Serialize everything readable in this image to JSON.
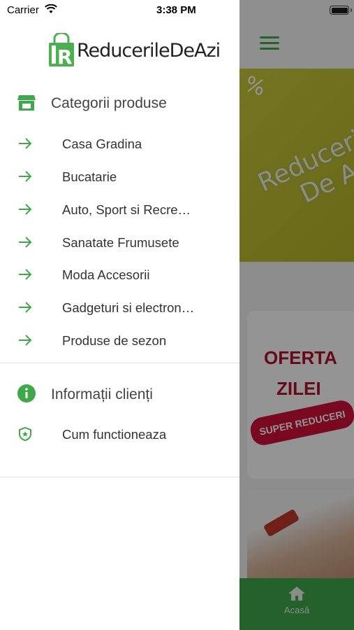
{
  "status_bar": {
    "carrier": "Carrier",
    "time": "3:38 PM"
  },
  "logo": {
    "text": "ReducerileDeAzi"
  },
  "drawer": {
    "categories_header": "Categorii produse",
    "categories": [
      {
        "label": "Casa Gradina"
      },
      {
        "label": "Bucatarie"
      },
      {
        "label": "Auto, Sport si Recreere"
      },
      {
        "label": "Sanatate Frumusete"
      },
      {
        "label": "Moda Accesorii"
      },
      {
        "label": "Gadgeturi si electronice"
      },
      {
        "label": "Produse de sezon"
      }
    ],
    "info_header": "Informații clienți",
    "info_items": [
      {
        "label": "Cum functioneaza"
      }
    ]
  },
  "background": {
    "banner": {
      "percent": "%",
      "text_line1": "Reduceri",
      "text_line2": "De Azi"
    },
    "offer": {
      "line1": "OFERTA",
      "line2": "ZILEI",
      "badge": "SUPER REDUCERI"
    },
    "tabbar": {
      "home_label": "Acasă"
    }
  },
  "colors": {
    "accent": "#3fa84a",
    "offer_red": "#b01030"
  }
}
